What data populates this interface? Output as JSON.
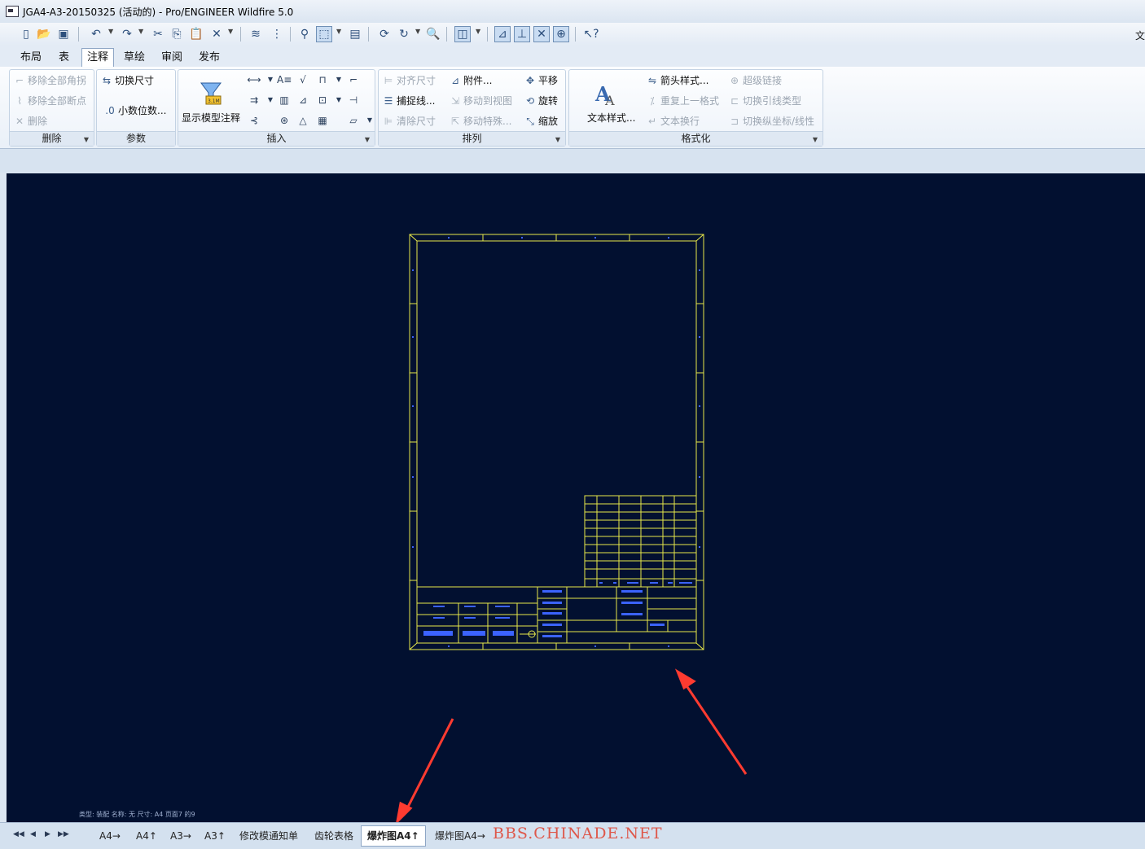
{
  "window": {
    "title": "JGA4-A3-20150325 (活动的) - Pro/ENGINEER Wildfire 5.0",
    "right_clip_text": "文"
  },
  "tabs": [
    "布局",
    "表",
    "注释",
    "草绘",
    "审阅",
    "发布"
  ],
  "ribbon": {
    "delete": {
      "label": "删除",
      "items": [
        "移除全部角拐",
        "移除全部断点",
        "删除"
      ]
    },
    "params": {
      "label": "参数",
      "items": [
        "切换尺寸",
        "小数位数..."
      ]
    },
    "insert": {
      "label": "插入",
      "big_button": "显示模型注释"
    },
    "arrange": {
      "label": "排列",
      "items": [
        "对齐尺寸",
        "捕捉线...",
        "清除尺寸",
        "附件...",
        "移动到视图",
        "移动特殊...",
        "平移",
        "旋转",
        "缩放"
      ]
    },
    "format": {
      "label": "格式化",
      "big_button": "文本样式...",
      "items": [
        "箭头样式...",
        "重复上一格式",
        "文本换行",
        "超级链接",
        "切换引线类型",
        "切换纵坐标/线性"
      ]
    }
  },
  "status": {
    "text": "类型: 装配    名称: 无    尺寸: A4    页面7 的9"
  },
  "sheets": [
    "A4→",
    "A4↑",
    "A3→",
    "A3↑",
    "修改模通知单",
    "齿轮表格",
    "爆炸图A4↑",
    "爆炸图A4→"
  ],
  "active_sheet": "爆炸图A4↑",
  "watermark": "BBS.CHINADE.NET",
  "colors": {
    "canvas": "#021030",
    "drawing_lines": "#e8e84a",
    "annotation": "#3b63ff",
    "arrow": "#ff3b30"
  }
}
